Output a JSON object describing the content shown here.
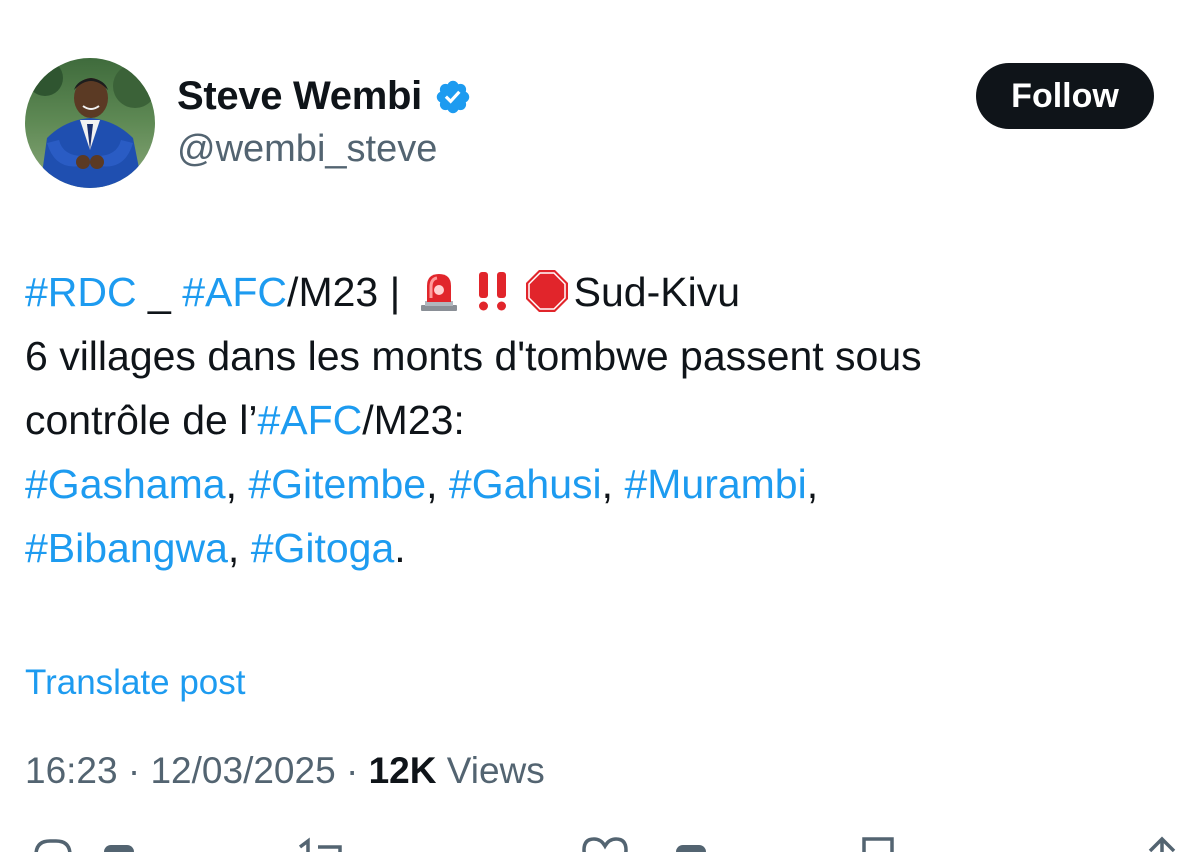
{
  "author": {
    "display_name": "Steve Wembi",
    "handle": "@wembi_steve",
    "verified_icon": "verified-badge-icon",
    "avatar_icon": "profile-photo"
  },
  "follow_button": {
    "label": "Follow"
  },
  "tweet": {
    "line1": {
      "tag_rdc": "#RDC",
      "sep": " _ ",
      "tag_afc": "#AFC",
      "rest": "/M23 | ",
      "emojis": [
        "rotating-light-icon",
        "double-exclamation-icon",
        "stop-sign-icon"
      ],
      "place": "Sud-Kivu"
    },
    "line2": "6 villages dans les monts d'tombwe passent sous",
    "line3": {
      "prefix": "contrôle de l’",
      "tag_afc": "#AFC",
      "suffix": "/M23:"
    },
    "line4": {
      "tags": [
        "#Gashama",
        "#Gitembe",
        "#Gahusi",
        "#Murambi"
      ],
      "separator": ", ",
      "trailing": ","
    },
    "line5": {
      "tags": [
        "#Bibangwa",
        "#Gitoga"
      ],
      "separator": ", ",
      "trailing": "."
    }
  },
  "translate_link": "Translate post",
  "meta": {
    "time": "16:23",
    "dot": " · ",
    "date": "12/03/2025",
    "views_count": "12K",
    "views_label": " Views"
  },
  "actions": [
    "reply-icon",
    "repost-icon",
    "like-icon",
    "bookmark-icon",
    "share-icon"
  ],
  "colors": {
    "link": "#1d9bf0",
    "text": "#0f1419",
    "secondary": "#536471",
    "button_bg": "#0f1419"
  }
}
